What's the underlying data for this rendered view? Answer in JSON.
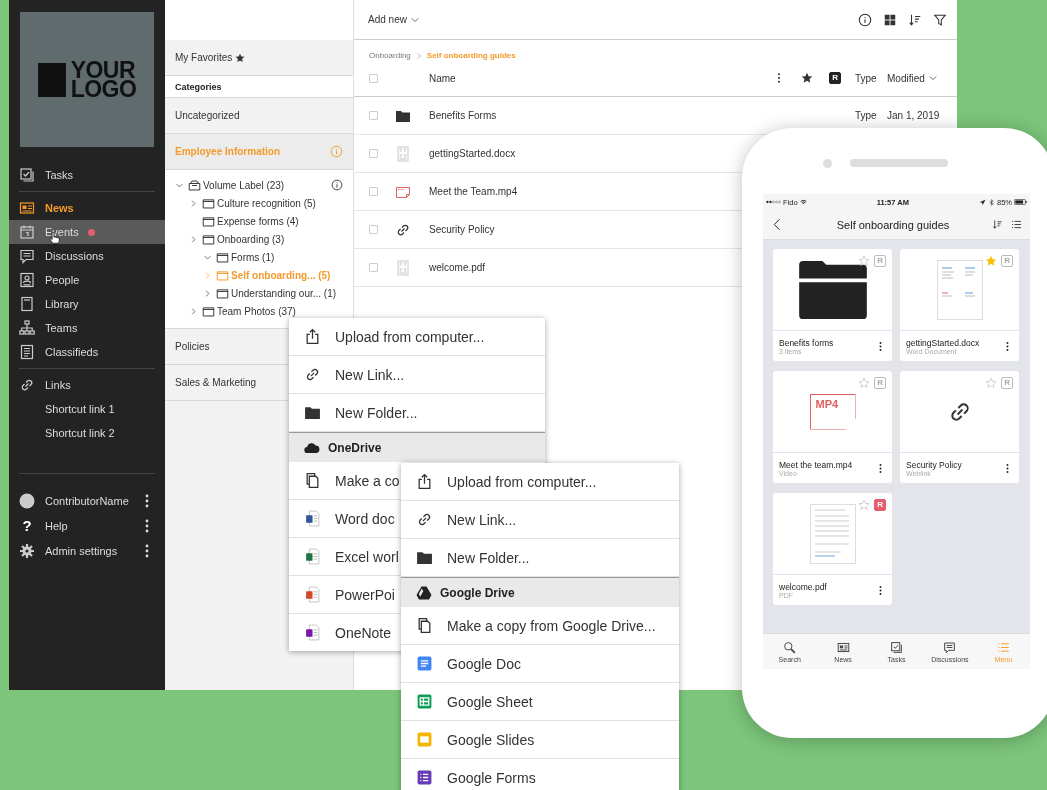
{
  "sidebar": {
    "logo": {
      "line1": "YOUR",
      "line2": "LOGO"
    },
    "sections": [
      [
        {
          "label": "Tasks",
          "selected": false,
          "hovered": false,
          "notification": false
        }
      ],
      [
        {
          "label": "News",
          "selected": true,
          "hovered": false,
          "notification": false
        },
        {
          "label": "Events",
          "selected": false,
          "hovered": true,
          "notification": true
        },
        {
          "label": "Discussions",
          "selected": false,
          "hovered": false,
          "notification": false
        },
        {
          "label": "People",
          "selected": false,
          "hovered": false,
          "notification": false
        },
        {
          "label": "Library",
          "selected": false,
          "hovered": false,
          "notification": false
        },
        {
          "label": "Teams",
          "selected": false,
          "hovered": false,
          "notification": false
        },
        {
          "label": "Classifieds",
          "selected": false,
          "hovered": false,
          "notification": false
        }
      ],
      [
        {
          "label": "Links",
          "selected": false,
          "hovered": false,
          "notification": false
        },
        {
          "label": "Shortcut link 1",
          "selected": false,
          "hovered": false,
          "notification": false
        },
        {
          "label": "Shortcut link 2",
          "selected": false,
          "hovered": false,
          "notification": false
        }
      ]
    ],
    "user_items": [
      {
        "label": "ContributorName"
      },
      {
        "label": "Help",
        "glyph": "?"
      },
      {
        "label": "Admin settings"
      }
    ]
  },
  "panel": {
    "favorites": "My Favorites",
    "categories_heading": "Categories",
    "categories": [
      {
        "label": "Uncategorized",
        "selected": false
      },
      {
        "label": "Employee Information",
        "selected": true,
        "info": true,
        "tree": [
          {
            "label": "Volume Label (23)",
            "kind": "volume",
            "expanded": true,
            "selected": false,
            "info": true,
            "children": [
              {
                "label": "Culture recognition (5)",
                "kind": "folder",
                "expanded": false,
                "selected": false
              },
              {
                "label": "Expense forms (4)",
                "kind": "folder",
                "selected": false
              },
              {
                "label": "Onboarding (3)",
                "kind": "folder",
                "expanded": false,
                "selected": false,
                "children": [
                  {
                    "label": "Forms (1)",
                    "kind": "folder",
                    "expanded": true,
                    "selected": false
                  },
                  {
                    "label": "Self onboarding... (5)",
                    "kind": "folder",
                    "expanded": false,
                    "selected": true
                  },
                  {
                    "label": "Understanding our... (1)",
                    "kind": "folder",
                    "expanded": false,
                    "selected": false
                  }
                ]
              },
              {
                "label": "Team Photos (37)",
                "kind": "folder",
                "expanded": false,
                "selected": false
              }
            ]
          }
        ]
      },
      {
        "label": "Policies",
        "selected": false
      },
      {
        "label": "Sales & Marketing",
        "selected": false
      }
    ]
  },
  "main": {
    "add_new": "Add new",
    "breadcrumb": [
      {
        "label": "Onboarding",
        "current": false
      },
      {
        "label": "Self onboarding guides",
        "current": true
      }
    ],
    "columns": {
      "name": "Name",
      "rights": "R",
      "type": "Type",
      "modified": "Modified"
    },
    "select_all_checked": false,
    "rows": [
      {
        "kind": "folder",
        "name": "Benefits Forms",
        "type": "Type",
        "modified": "Jan 1, 2019",
        "checked": false
      },
      {
        "kind": "doc",
        "name": "gettingStarted.docx",
        "checked": false
      },
      {
        "kind": "video",
        "name": "Meet the Team.mp4",
        "checked": false
      },
      {
        "kind": "link",
        "name": "Security Policy",
        "checked": false
      },
      {
        "kind": "pdf",
        "name": "welcome.pdf",
        "checked": false
      }
    ]
  },
  "menus": [
    {
      "items": [
        {
          "kind": "item",
          "label": "Upload from computer..."
        },
        {
          "kind": "item",
          "label": "New Link..."
        },
        {
          "kind": "item",
          "label": "New Folder..."
        },
        {
          "kind": "header",
          "label": "OneDrive"
        },
        {
          "kind": "item",
          "label": "Make a co"
        },
        {
          "kind": "item",
          "label": "Word doc"
        },
        {
          "kind": "item",
          "label": "Excel worl"
        },
        {
          "kind": "item",
          "label": "PowerPoi"
        },
        {
          "kind": "item",
          "label": "OneNote"
        }
      ]
    },
    {
      "items": [
        {
          "kind": "item",
          "label": "Upload from computer..."
        },
        {
          "kind": "item",
          "label": "New Link..."
        },
        {
          "kind": "item",
          "label": "New Folder..."
        },
        {
          "kind": "header",
          "label": "Google Drive"
        },
        {
          "kind": "item",
          "label": "Make a copy from Google Drive..."
        },
        {
          "kind": "item",
          "label": "Google Doc"
        },
        {
          "kind": "item",
          "label": "Google Sheet"
        },
        {
          "kind": "item",
          "label": "Google Slides"
        },
        {
          "kind": "item",
          "label": "Google Forms"
        }
      ]
    }
  ],
  "phone": {
    "carrier": "Fido",
    "time": "11:57 AM",
    "battery": "85%",
    "title": "Self onboarding guides",
    "cards": [
      {
        "kind": "folder",
        "title": "Benefits forms",
        "subtitle": "3 items",
        "starred": false,
        "badge": "R",
        "restricted": false
      },
      {
        "kind": "doc",
        "title": "gettingStarted.docx",
        "subtitle": "Word Document",
        "starred": true,
        "badge": "R",
        "restricted": false
      },
      {
        "kind": "video",
        "thumb_label": "MP4",
        "title": "Meet the team.mp4",
        "subtitle": "Video",
        "starred": false,
        "badge": "R",
        "restricted": false
      },
      {
        "kind": "link",
        "title": "Security Policy",
        "subtitle": "Weblink",
        "starred": false,
        "badge": "R",
        "restricted": false
      },
      {
        "kind": "pdf",
        "title": "welcome.pdf",
        "subtitle": "PDF",
        "starred": false,
        "badge": "R",
        "restricted": true
      }
    ],
    "tabs": [
      {
        "label": "Search",
        "selected": false
      },
      {
        "label": "News",
        "selected": false
      },
      {
        "label": "Tasks",
        "selected": false
      },
      {
        "label": "Discussions",
        "selected": false
      },
      {
        "label": "Menu",
        "selected": true
      }
    ]
  }
}
